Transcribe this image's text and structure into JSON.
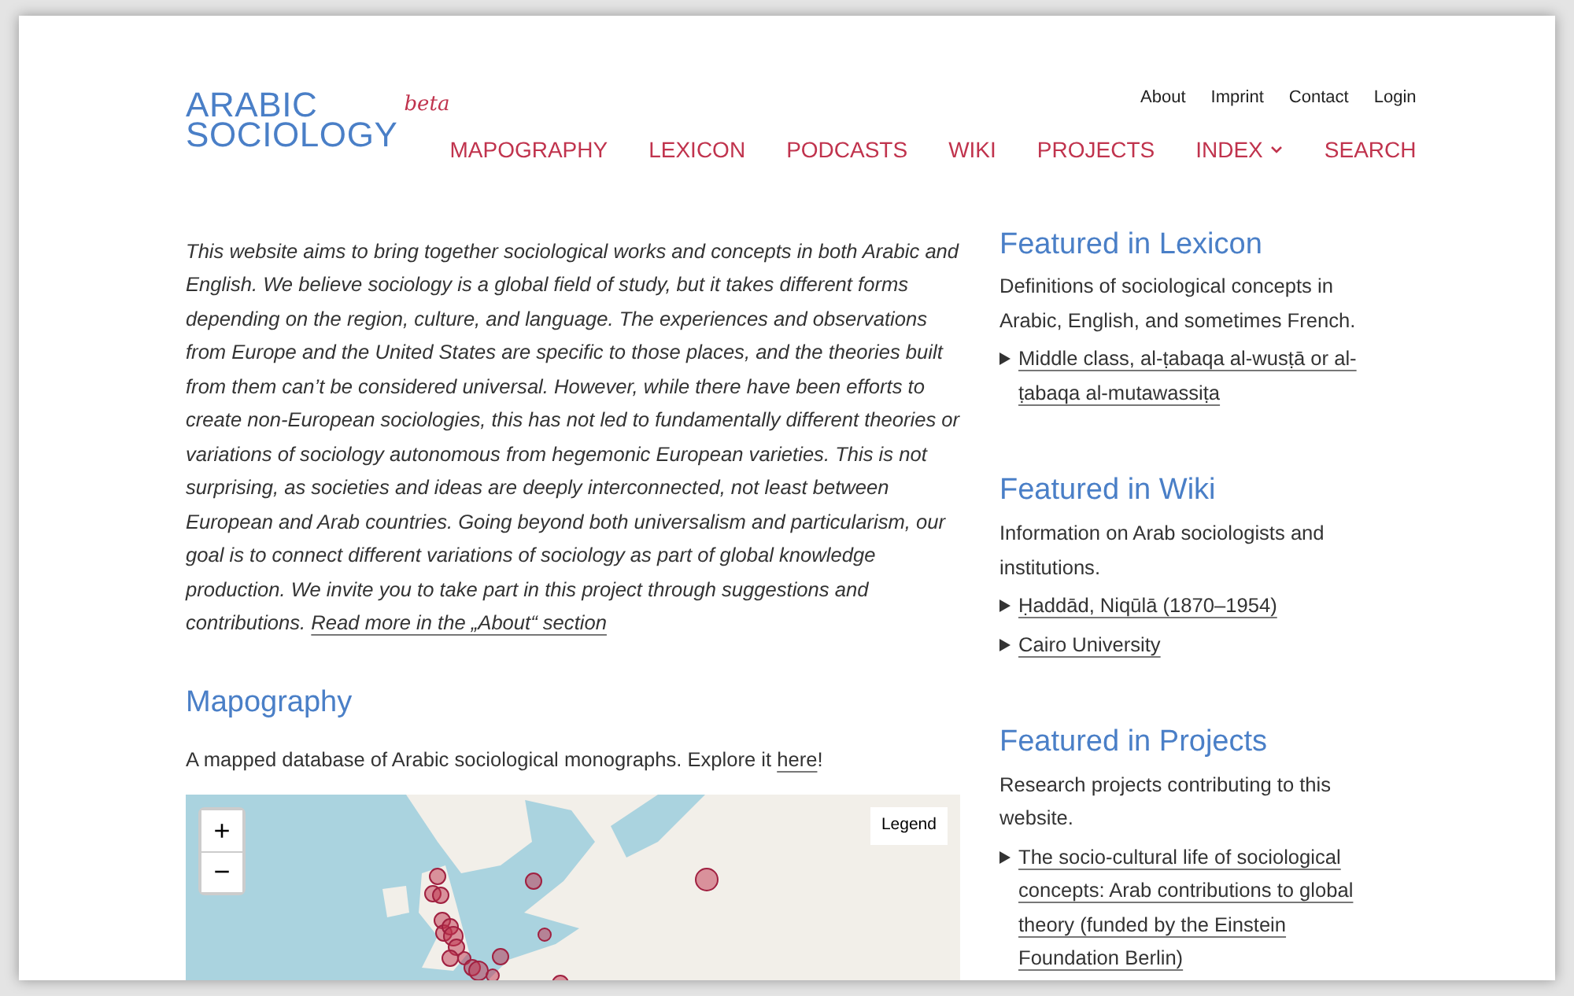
{
  "logo": {
    "lines": [
      "ARABIC",
      "SOCIOLOGY"
    ],
    "badge": "beta"
  },
  "top_links": [
    "About",
    "Imprint",
    "Contact",
    "Login"
  ],
  "nav": [
    {
      "label": "MAPOGRAPHY",
      "has_menu": false
    },
    {
      "label": "LEXICON",
      "has_menu": false
    },
    {
      "label": "PODCASTS",
      "has_menu": false
    },
    {
      "label": "WIKI",
      "has_menu": false
    },
    {
      "label": "PROJECTS",
      "has_menu": false
    },
    {
      "label": "INDEX",
      "has_menu": true
    },
    {
      "label": "SEARCH",
      "has_menu": false
    }
  ],
  "intro": {
    "text": "This website aims to bring together sociological works and concepts in both Arabic and English. We believe sociology is a global field of study, but it takes different forms depending on the region, culture, and language. The experiences and observations from Europe and the United States are specific to those places, and the theories built from them can’t be considered universal. However, while there have been efforts to create non-European sociologies, this has not led to fundamentally different theories or variations of sociology autonomous from hegemonic European varieties. This is not surprising, as societies and ideas are deeply interconnected, not least between European and Arab countries. Going beyond both universalism and particularism, our goal is to connect different variations of sociology as part of global knowledge production. We invite you to take part in this project through suggestions and contributions.",
    "link": "Read more in the „About“ section"
  },
  "mapography": {
    "title": "Mapography",
    "text": "A mapped database of Arabic sociological monographs. Explore it",
    "link": "here",
    "after": "!",
    "map": {
      "kind": "picture",
      "zoom_in": "+",
      "zoom_out": "−",
      "legend": "Legend"
    }
  },
  "featured": [
    {
      "title": "Featured in Lexicon",
      "description": "Definitions of sociological concepts in Arabic, English, and sometimes French.",
      "links": [
        "Middle class, al-ṭabaqa al-wusṭā or al-ṭabaqa al-mutawassiṭa"
      ]
    },
    {
      "title": "Featured in Wiki",
      "description": "Information on Arab sociologists and institutions.",
      "links": [
        "Ḥaddād, Niqūlā (1870–1954)",
        "Cairo University"
      ]
    },
    {
      "title": "Featured in Projects",
      "description": "Research projects contributing to this website.",
      "links": [
        "The socio-cultural life of sociological concepts: Arab contributions to global theory (funded by the Einstein Foundation Berlin)"
      ]
    }
  ]
}
